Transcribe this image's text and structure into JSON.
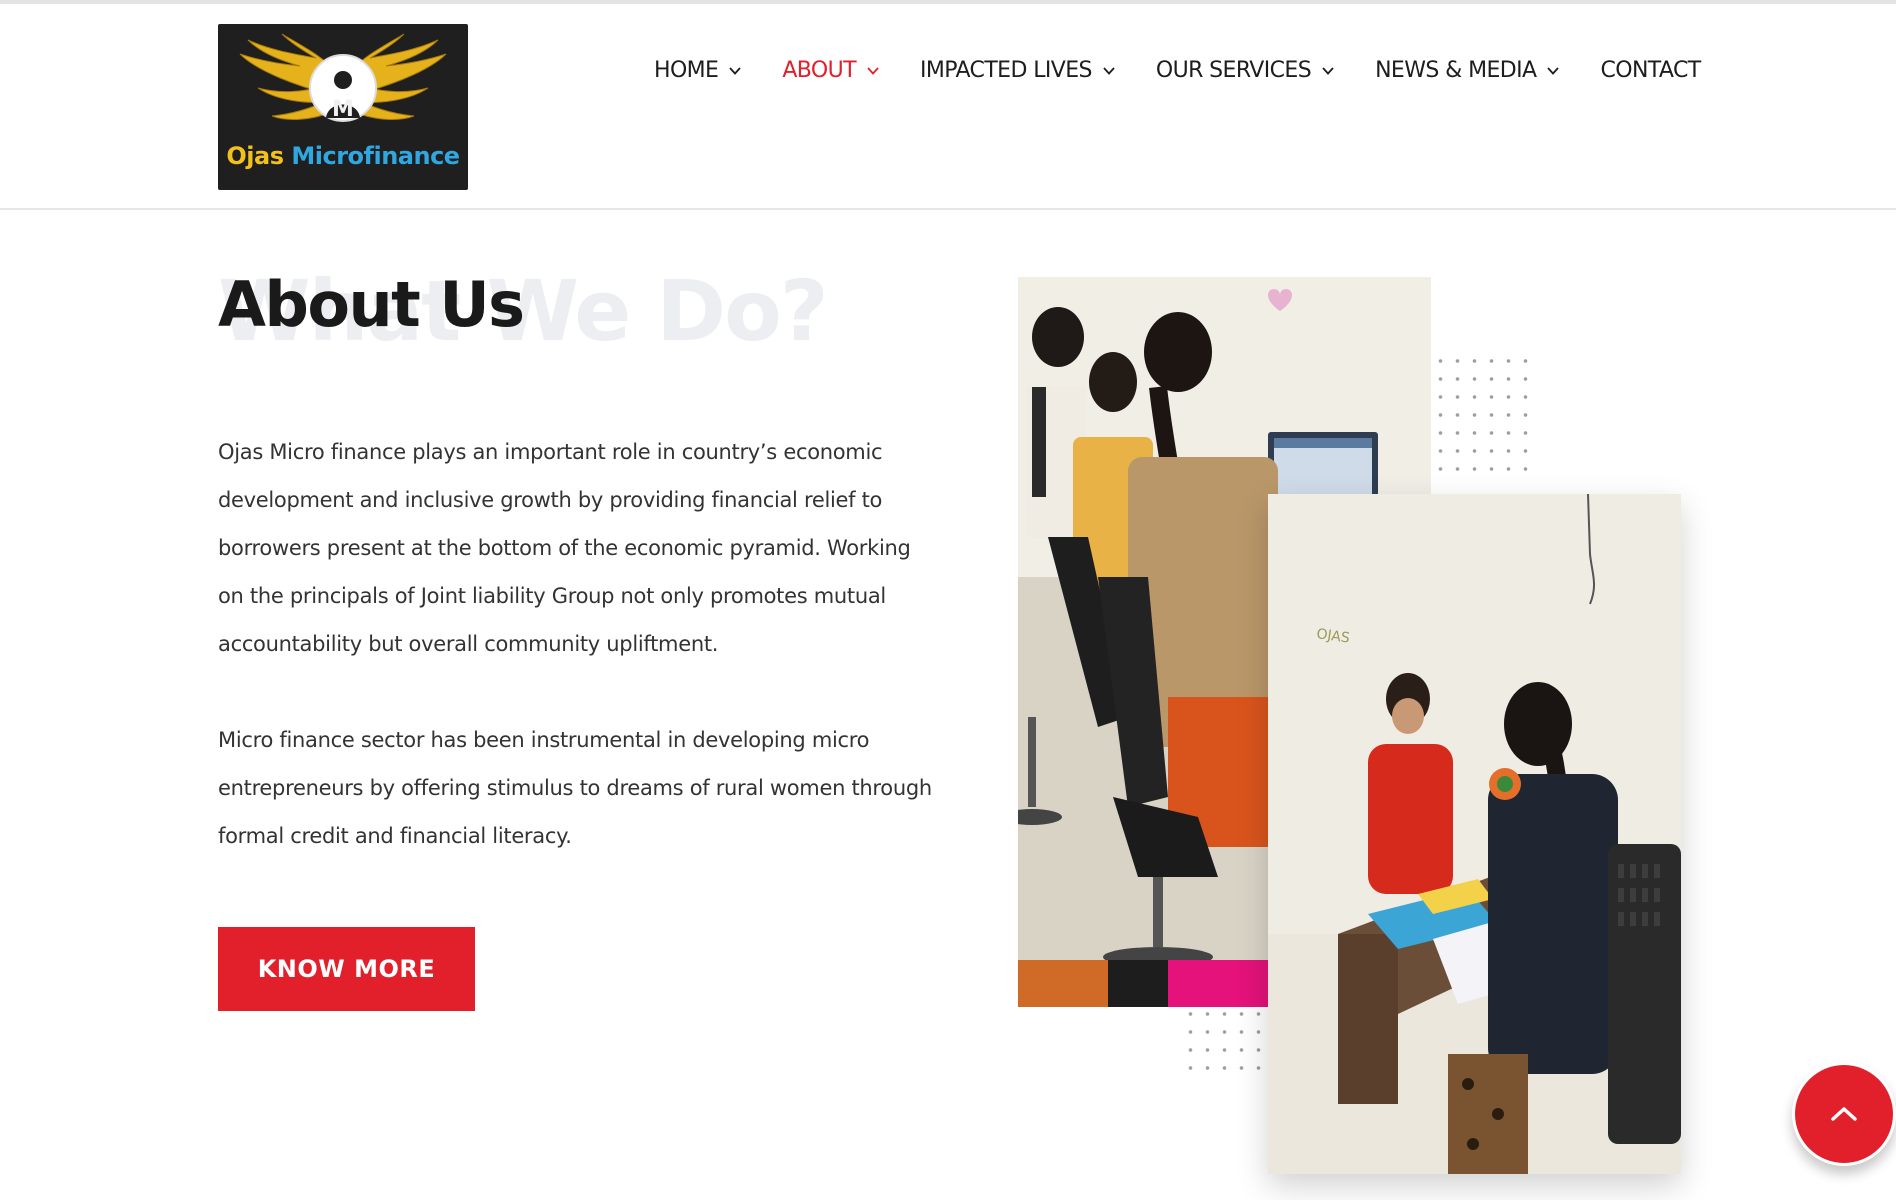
{
  "brand": {
    "logo_word1": "Ojas",
    "logo_word2": "Microfinance",
    "logo_letter": "M",
    "colors": {
      "gold": "#f2c21a",
      "blue": "#2fa7e0",
      "logo_bg": "#1f1f1f"
    }
  },
  "nav": {
    "items": [
      {
        "label": "HOME",
        "has_dropdown": true,
        "active": false
      },
      {
        "label": "ABOUT",
        "has_dropdown": true,
        "active": true
      },
      {
        "label": "IMPACTED LIVES",
        "has_dropdown": true,
        "active": false
      },
      {
        "label": "OUR SERVICES",
        "has_dropdown": true,
        "active": false
      },
      {
        "label": "NEWS & MEDIA",
        "has_dropdown": true,
        "active": false
      },
      {
        "label": "CONTACT",
        "has_dropdown": false,
        "active": false
      }
    ],
    "active_color": "#e2202c"
  },
  "about": {
    "ghost_title": "What We Do?",
    "title": "About Us",
    "paragraph1": "Ojas Micro finance plays an important role in country’s economic development and inclusive growth by providing financial relief to borrowers present at the bottom of the economic pyramid. Working on the principals of Joint liability Group not only promotes mutual accountability but overall community upliftment.",
    "paragraph2": "Micro finance sector has been instrumental in developing micro entrepreneurs by offering stimulus to dreams of rural women through formal credit and financial literacy.",
    "button_label": "KNOW MORE",
    "photo2_wall_text": "OJAS"
  },
  "icons": {
    "dropdown": "chevron-down-icon",
    "scroll_top": "chevron-up-icon"
  },
  "theme": {
    "accent": "#e2202c",
    "text": "#333333"
  }
}
